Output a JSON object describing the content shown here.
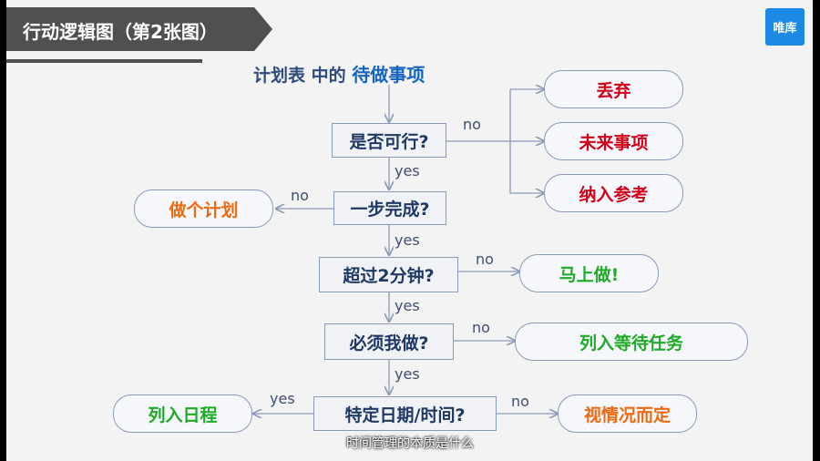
{
  "header": {
    "title": "行动逻辑图（第2张图）",
    "logo_text": "唯库"
  },
  "top_label": {
    "part1": "计划表 中的 ",
    "part2": "待做事项"
  },
  "questions": {
    "feasible": "是否可行?",
    "one_step": "一步完成?",
    "two_minutes": "超过2分钟?",
    "must_do": "必须我做?",
    "specific_date": "特定日期/时间?"
  },
  "outcomes": {
    "discard": "丢弃",
    "future": "未来事项",
    "reference": "纳入参考",
    "make_plan": "做个计划",
    "do_now": "马上做!",
    "waiting": "列入等待任务",
    "schedule": "列入日程",
    "depends": "视情况而定"
  },
  "edge_labels": {
    "no": "no",
    "yes": "yes"
  },
  "colors": {
    "red": "#d0021b",
    "orange": "#ee6a10",
    "green": "#1faa28",
    "node_text": "#1f3864"
  },
  "subtitle": "时间管理的本质是什么"
}
